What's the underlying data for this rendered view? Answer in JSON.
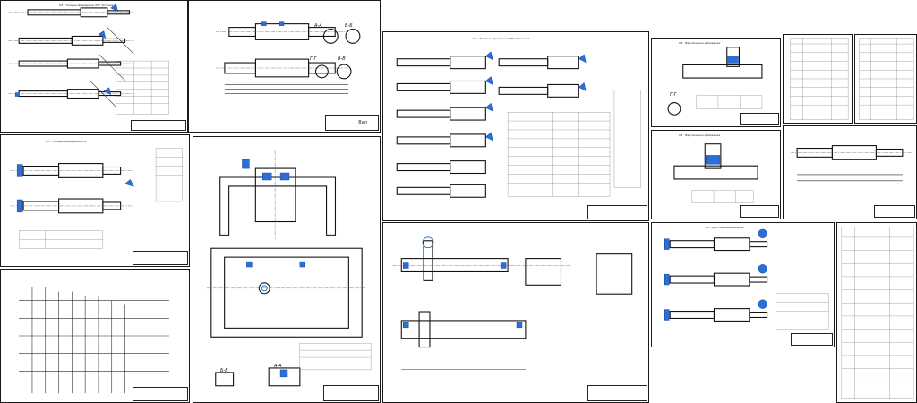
{
  "sheets": [
    {
      "id": "s1",
      "title": "ОЗ - Токарно-фрезерная ЧПУ. Установ Б",
      "stamp": ""
    },
    {
      "id": "s2",
      "title": "Вал",
      "stamp": "Вал"
    },
    {
      "id": "s3",
      "title": "ОЗ - Токарно-фрезерная ЧПУ. Установ А",
      "stamp": ""
    },
    {
      "id": "s4",
      "title": "ОЗ - Вертикально-фрезерная",
      "stamp": ""
    },
    {
      "id": "s5",
      "title": "",
      "stamp": ""
    },
    {
      "id": "s6",
      "title": "",
      "stamp": ""
    },
    {
      "id": "s7",
      "title": "ОЗ - Токарно-фрезерная ЧПУ",
      "stamp": ""
    },
    {
      "id": "s8",
      "title": "",
      "stamp": ""
    },
    {
      "id": "s9",
      "title": "",
      "stamp": ""
    },
    {
      "id": "s10",
      "title": "",
      "stamp": ""
    },
    {
      "id": "s11",
      "title": "ОЗ - Вертикально-фрезерная",
      "stamp": ""
    },
    {
      "id": "s12",
      "title": "",
      "stamp": ""
    },
    {
      "id": "s13",
      "title": "",
      "stamp": ""
    },
    {
      "id": "s14",
      "title": "ОЗ - Круглошлифовальная",
      "stamp": ""
    },
    {
      "id": "s15",
      "title": "",
      "stamp": ""
    },
    {
      "id": "s16",
      "title": "",
      "stamp": ""
    }
  ],
  "sections": {
    "ab": "А-А",
    "bb": "Б-Б",
    "vv": "В-В",
    "gg": "Г-Г",
    "aa2": "А-А",
    "bb2": "Б-Б"
  },
  "colors": {
    "line": "#2a2a2a",
    "accent": "#1565c0",
    "fill": "#2d6fd6",
    "paper": "#ffffff"
  }
}
